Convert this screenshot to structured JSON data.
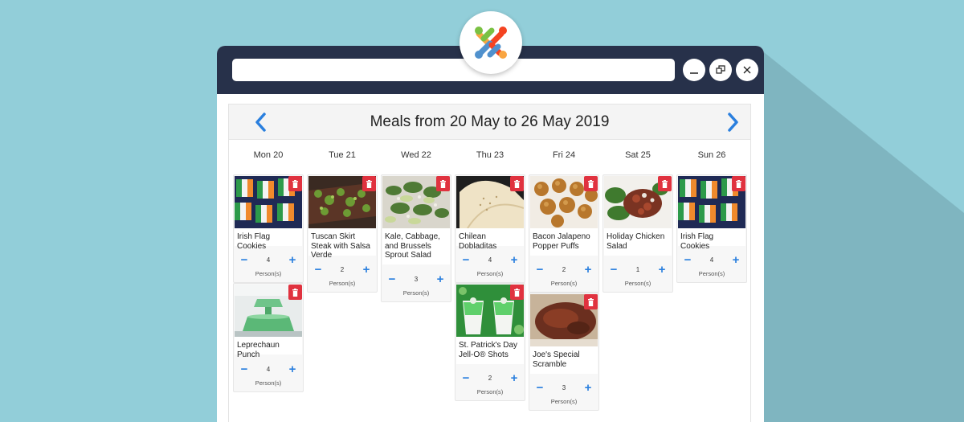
{
  "colors": {
    "background": "#92ced9",
    "titlebar": "#27314a",
    "accent_blue": "#2a7fde",
    "delete_red": "#e0323f"
  },
  "window": {
    "address_value": "",
    "minimize_icon": "minimize-icon",
    "restore_icon": "restore-icon",
    "close_icon": "close-icon"
  },
  "planner": {
    "title": "Meals from 20 May to 26 May 2019",
    "prev_icon": "chevron-left-icon",
    "next_icon": "chevron-right-icon",
    "persons_label": "Person(s)",
    "days": [
      {
        "label": "Mon 20",
        "meals": [
          {
            "name": "Irish Flag Cookies",
            "persons": "4"
          },
          {
            "name": "Leprechaun Punch",
            "persons": "4"
          }
        ]
      },
      {
        "label": "Tue 21",
        "meals": [
          {
            "name": "Tuscan Skirt Steak with Salsa Verde",
            "persons": "2"
          }
        ]
      },
      {
        "label": "Wed 22",
        "meals": [
          {
            "name": "Kale, Cabbage, and Brussels Sprout Salad",
            "persons": "3"
          }
        ]
      },
      {
        "label": "Thu 23",
        "meals": [
          {
            "name": "Chilean Dobladitas",
            "persons": "4"
          },
          {
            "name": "St. Patrick's Day Jell-O® Shots",
            "persons": "2"
          }
        ]
      },
      {
        "label": "Fri 24",
        "meals": [
          {
            "name": "Bacon Jalapeno Popper Puffs",
            "persons": "2"
          },
          {
            "name": "Joe's Special Scramble",
            "persons": "3"
          }
        ]
      },
      {
        "label": "Sat 25",
        "meals": [
          {
            "name": "Holiday Chicken Salad",
            "persons": "1"
          }
        ]
      },
      {
        "label": "Sun 26",
        "meals": [
          {
            "name": "Irish Flag Cookies",
            "persons": "4"
          }
        ]
      }
    ]
  }
}
